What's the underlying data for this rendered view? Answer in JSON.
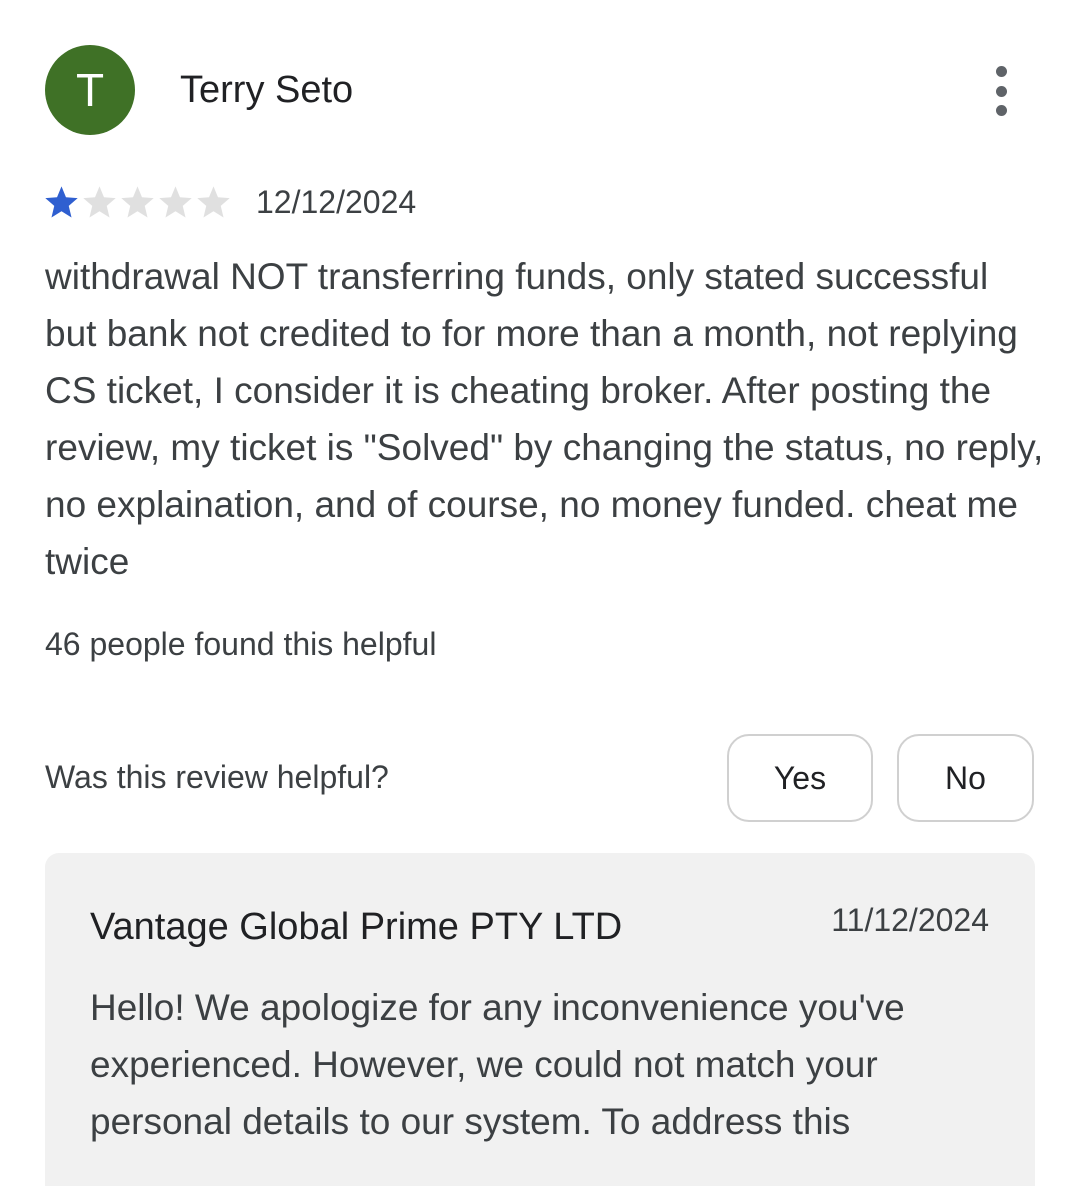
{
  "review": {
    "avatar_letter": "T",
    "avatar_color": "#3f7126",
    "author": "Terry Seto",
    "menu_icon": "more-vert-icon",
    "rating": 1,
    "rating_max": 5,
    "star_filled_color": "#2f5fd0",
    "star_empty_color": "#e0e0e0",
    "date": "12/12/2024",
    "text": "withdrawal NOT transferring funds, only stated successful but bank not credited to for more than a month, not replying CS ticket, I consider it is cheating broker. After posting the review, my ticket is \"Solved\" by changing the status, no reply, no explaination, and of course, no money funded. cheat me twice",
    "helpful_count_text": "46 people found this helpful"
  },
  "feedback": {
    "question": "Was this review helpful?",
    "yes_label": "Yes",
    "no_label": "No"
  },
  "developer_reply": {
    "author": "Vantage Global Prime PTY LTD",
    "date": "11/12/2024",
    "text": "Hello! We apologize for any inconvenience you've experienced. However, we could not match your personal details to our system. To address this"
  }
}
